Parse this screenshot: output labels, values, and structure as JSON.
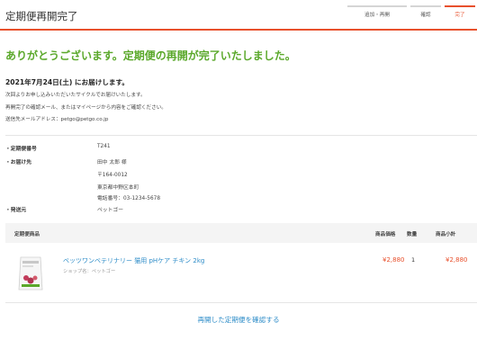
{
  "header": {
    "title": "定期便再開完了",
    "steps": [
      "追加・再開",
      "確認",
      "完了"
    ]
  },
  "colors": {
    "accent": "#e8502c",
    "success": "#5aa82a",
    "link": "#2d8cc8"
  },
  "message": {
    "headline": "ありがとうございます。定期便の再開が完了いたしました。",
    "delivery_date": "2021年7月24日(土) にお届けします。",
    "line1": "次回よりお申し込みいただいたサイクルでお届けいたします。",
    "line2": "再開完了の確認メール、またはマイページから内容をご確認ください。",
    "line3": "送信先メールアドレス：petgo@petgo.co.jp"
  },
  "details": {
    "number_label": "・定期便番号",
    "number": "T241",
    "address_label": "・お届け先",
    "name": "田中 太郎 様",
    "postal": "〒164-0012",
    "address": "東京都中野区本町",
    "phone": "電話番号：03-1234-5678",
    "sender_label": "・発送元",
    "sender": "ペットゴー"
  },
  "table": {
    "col_product": "定期便商品",
    "col_price": "商品価格",
    "col_qty": "数量",
    "col_subtotal": "商品小計"
  },
  "product": {
    "name": "ベッツワンベテリナリー 猫用 pHケア チキン 2kg",
    "shop": "ショップ名：ペットゴー",
    "price": "¥2,880",
    "qty": "1",
    "subtotal": "¥2,880",
    "icon": "pet-food-bag-icon"
  },
  "footer": {
    "confirm_link": "再開した定期便を確認する"
  }
}
